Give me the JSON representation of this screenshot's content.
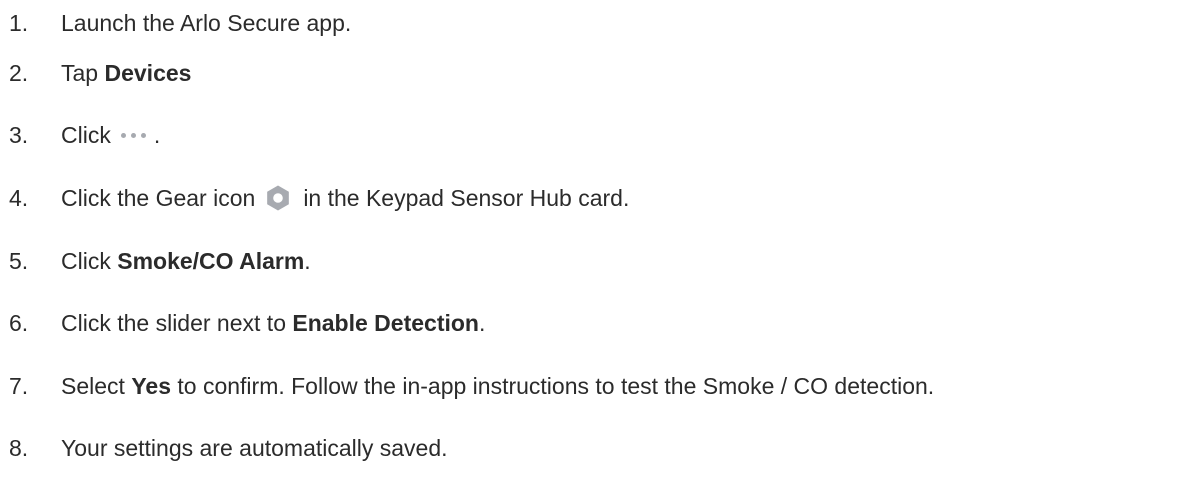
{
  "steps": [
    {
      "number": "1.",
      "parts": {
        "t1": "Launch the Arlo Secure app."
      }
    },
    {
      "number": "2.",
      "parts": {
        "t1": "Tap ",
        "b1": "Devices"
      }
    },
    {
      "number": "3.",
      "parts": {
        "t1": "Click",
        "icon": "more-dots-icon",
        "t2": "."
      }
    },
    {
      "number": "4.",
      "parts": {
        "t1": "Click the Gear icon",
        "icon": "gear-icon",
        "t2": "in the Keypad Sensor Hub card."
      }
    },
    {
      "number": "5.",
      "parts": {
        "t1": "Click ",
        "b1": "Smoke/CO Alarm",
        "t2": "."
      }
    },
    {
      "number": "6.",
      "parts": {
        "t1": "Click the slider next to ",
        "b1": "Enable Detection",
        "t2": "."
      }
    },
    {
      "number": "7.",
      "parts": {
        "t1": "Select ",
        "b1": "Yes",
        "t2": " to confirm. Follow the in-app instructions to test the Smoke / CO detection."
      }
    },
    {
      "number": "8.",
      "parts": {
        "t1": "Your settings are automatically saved."
      }
    }
  ],
  "colors": {
    "text": "#2b2b2b",
    "icon": "#a7aab0"
  }
}
